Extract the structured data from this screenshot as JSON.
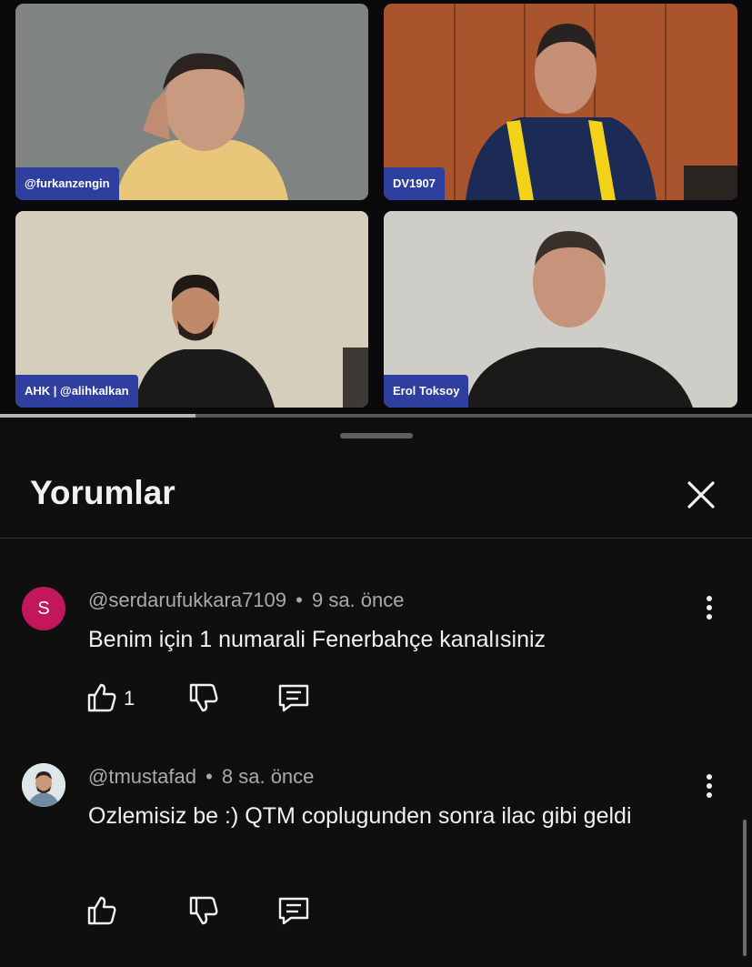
{
  "video": {
    "participants": [
      {
        "name": "@furkanzengin"
      },
      {
        "name": "DV1907"
      },
      {
        "name": "AHK | @alihkalkan"
      },
      {
        "name": "Erol Toksoy"
      }
    ],
    "progress_fraction": 0.26
  },
  "comments_panel": {
    "title": "Yorumlar",
    "close_icon": "close-icon",
    "comments": [
      {
        "avatar_letter": "S",
        "avatar_color": "#c2185b",
        "author": "@serdarufukkara7109",
        "separator": "•",
        "time": "9 sa. önce",
        "text": "Benim için 1 numarali Fenerbahçe kanalısiniz",
        "like_count": "1"
      },
      {
        "avatar_letter": "",
        "author": "@tmustafad",
        "separator": "•",
        "time": "8 sa. önce",
        "text": "Ozlemisiz be :) QTM coplugunden sonra ilac gibi geldi",
        "like_count": ""
      }
    ]
  },
  "colors": {
    "background": "#0f0f0f",
    "text_primary": "#f1f1f1",
    "text_secondary": "#aaaaaa",
    "name_tag": "#2f3f9f"
  }
}
